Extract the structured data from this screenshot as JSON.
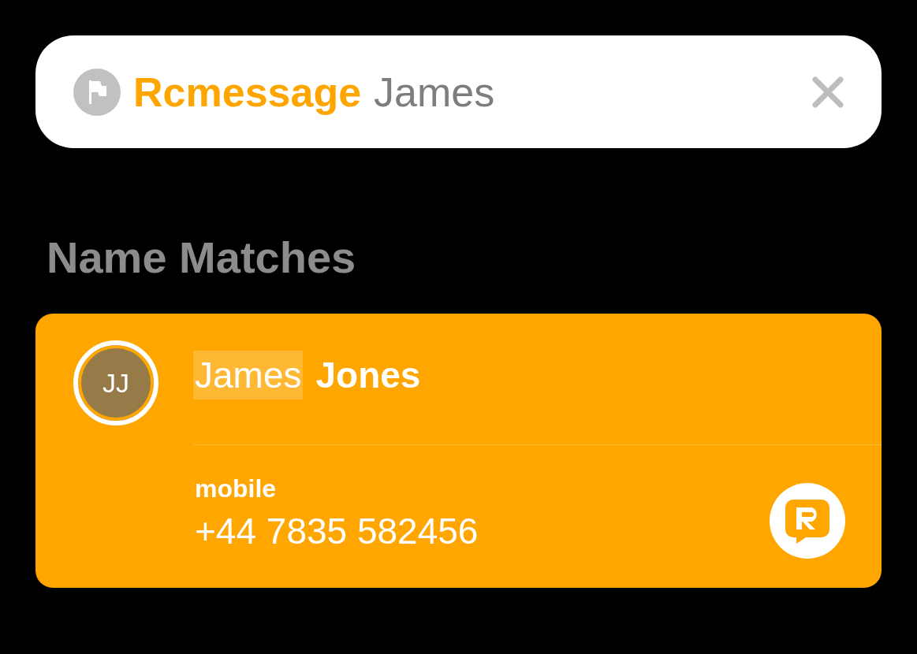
{
  "search": {
    "scope": "Rcmessage",
    "query": "James"
  },
  "section_title": "Name Matches",
  "contact": {
    "initials": "JJ",
    "name_parts": [
      {
        "text": "James",
        "highlighted": true
      },
      {
        "text": "Jones",
        "highlighted": false
      }
    ],
    "phone_label": "mobile",
    "phone": "+44 7835 582456"
  }
}
